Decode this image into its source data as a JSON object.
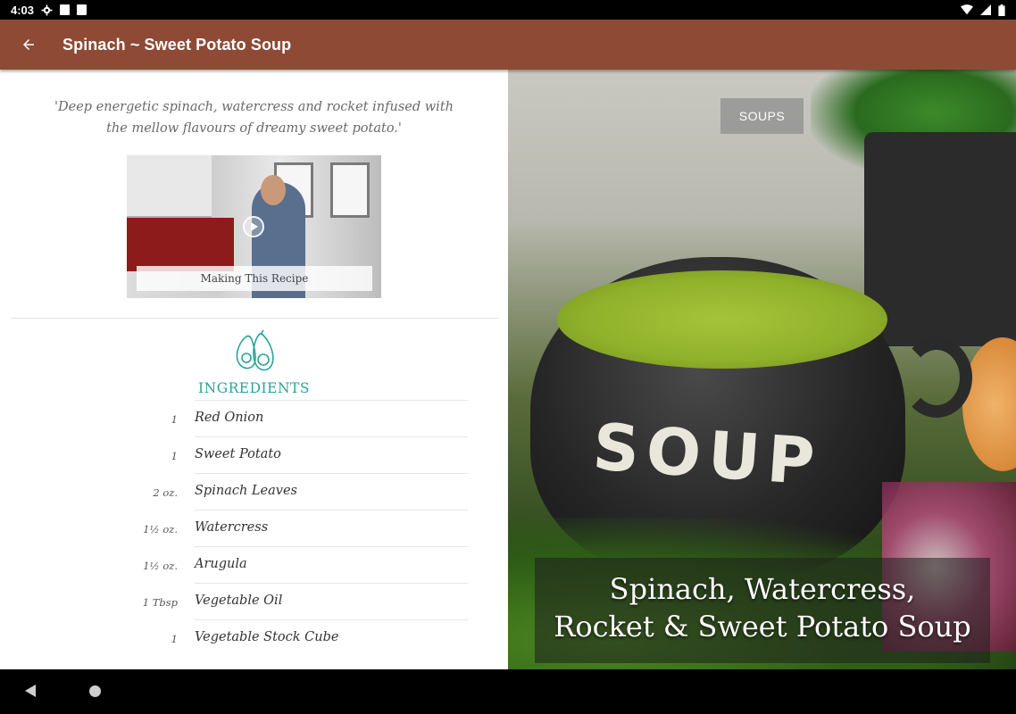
{
  "status_bar": {
    "time": "4:03",
    "left_icons": [
      "gear-icon",
      "text-a-icon",
      "sd-card-icon"
    ],
    "right_icons": [
      "wifi-icon",
      "signal-icon",
      "battery-icon"
    ]
  },
  "app_bar": {
    "back_icon": "arrow-left-icon",
    "title": "Spinach ~ Sweet Potato Soup",
    "color": "#8e4a35"
  },
  "recipe": {
    "quote": "'Deep energetic spinach, watercress and rocket infused with the mellow flavours of dreamy sweet potato.'",
    "video_caption": "Making This Recipe",
    "ingredients_title": "INGREDIENTS",
    "ingredients_icon": "avocado-icon",
    "accent_color": "#2aa39a",
    "ingredients": [
      {
        "qty": "1",
        "name": "Red Onion"
      },
      {
        "qty": "1",
        "name": "Sweet Potato"
      },
      {
        "qty": "2 oz.",
        "name": "Spinach Leaves"
      },
      {
        "qty": "1½ oz.",
        "name": "Watercress"
      },
      {
        "qty": "1½ oz.",
        "name": "Arugula"
      },
      {
        "qty": "1 Tbsp",
        "name": "Vegetable Oil"
      },
      {
        "qty": "1",
        "name": "Vegetable Stock Cube"
      }
    ]
  },
  "hero": {
    "category_tag": "SOUPS",
    "bowl_text": "SOUP",
    "title_line1": "Spinach, Watercress,",
    "title_line2": "Rocket & Sweet Potato Soup"
  },
  "nav_bar": {
    "back_icon": "nav-back-icon",
    "home_icon": "nav-home-icon"
  }
}
